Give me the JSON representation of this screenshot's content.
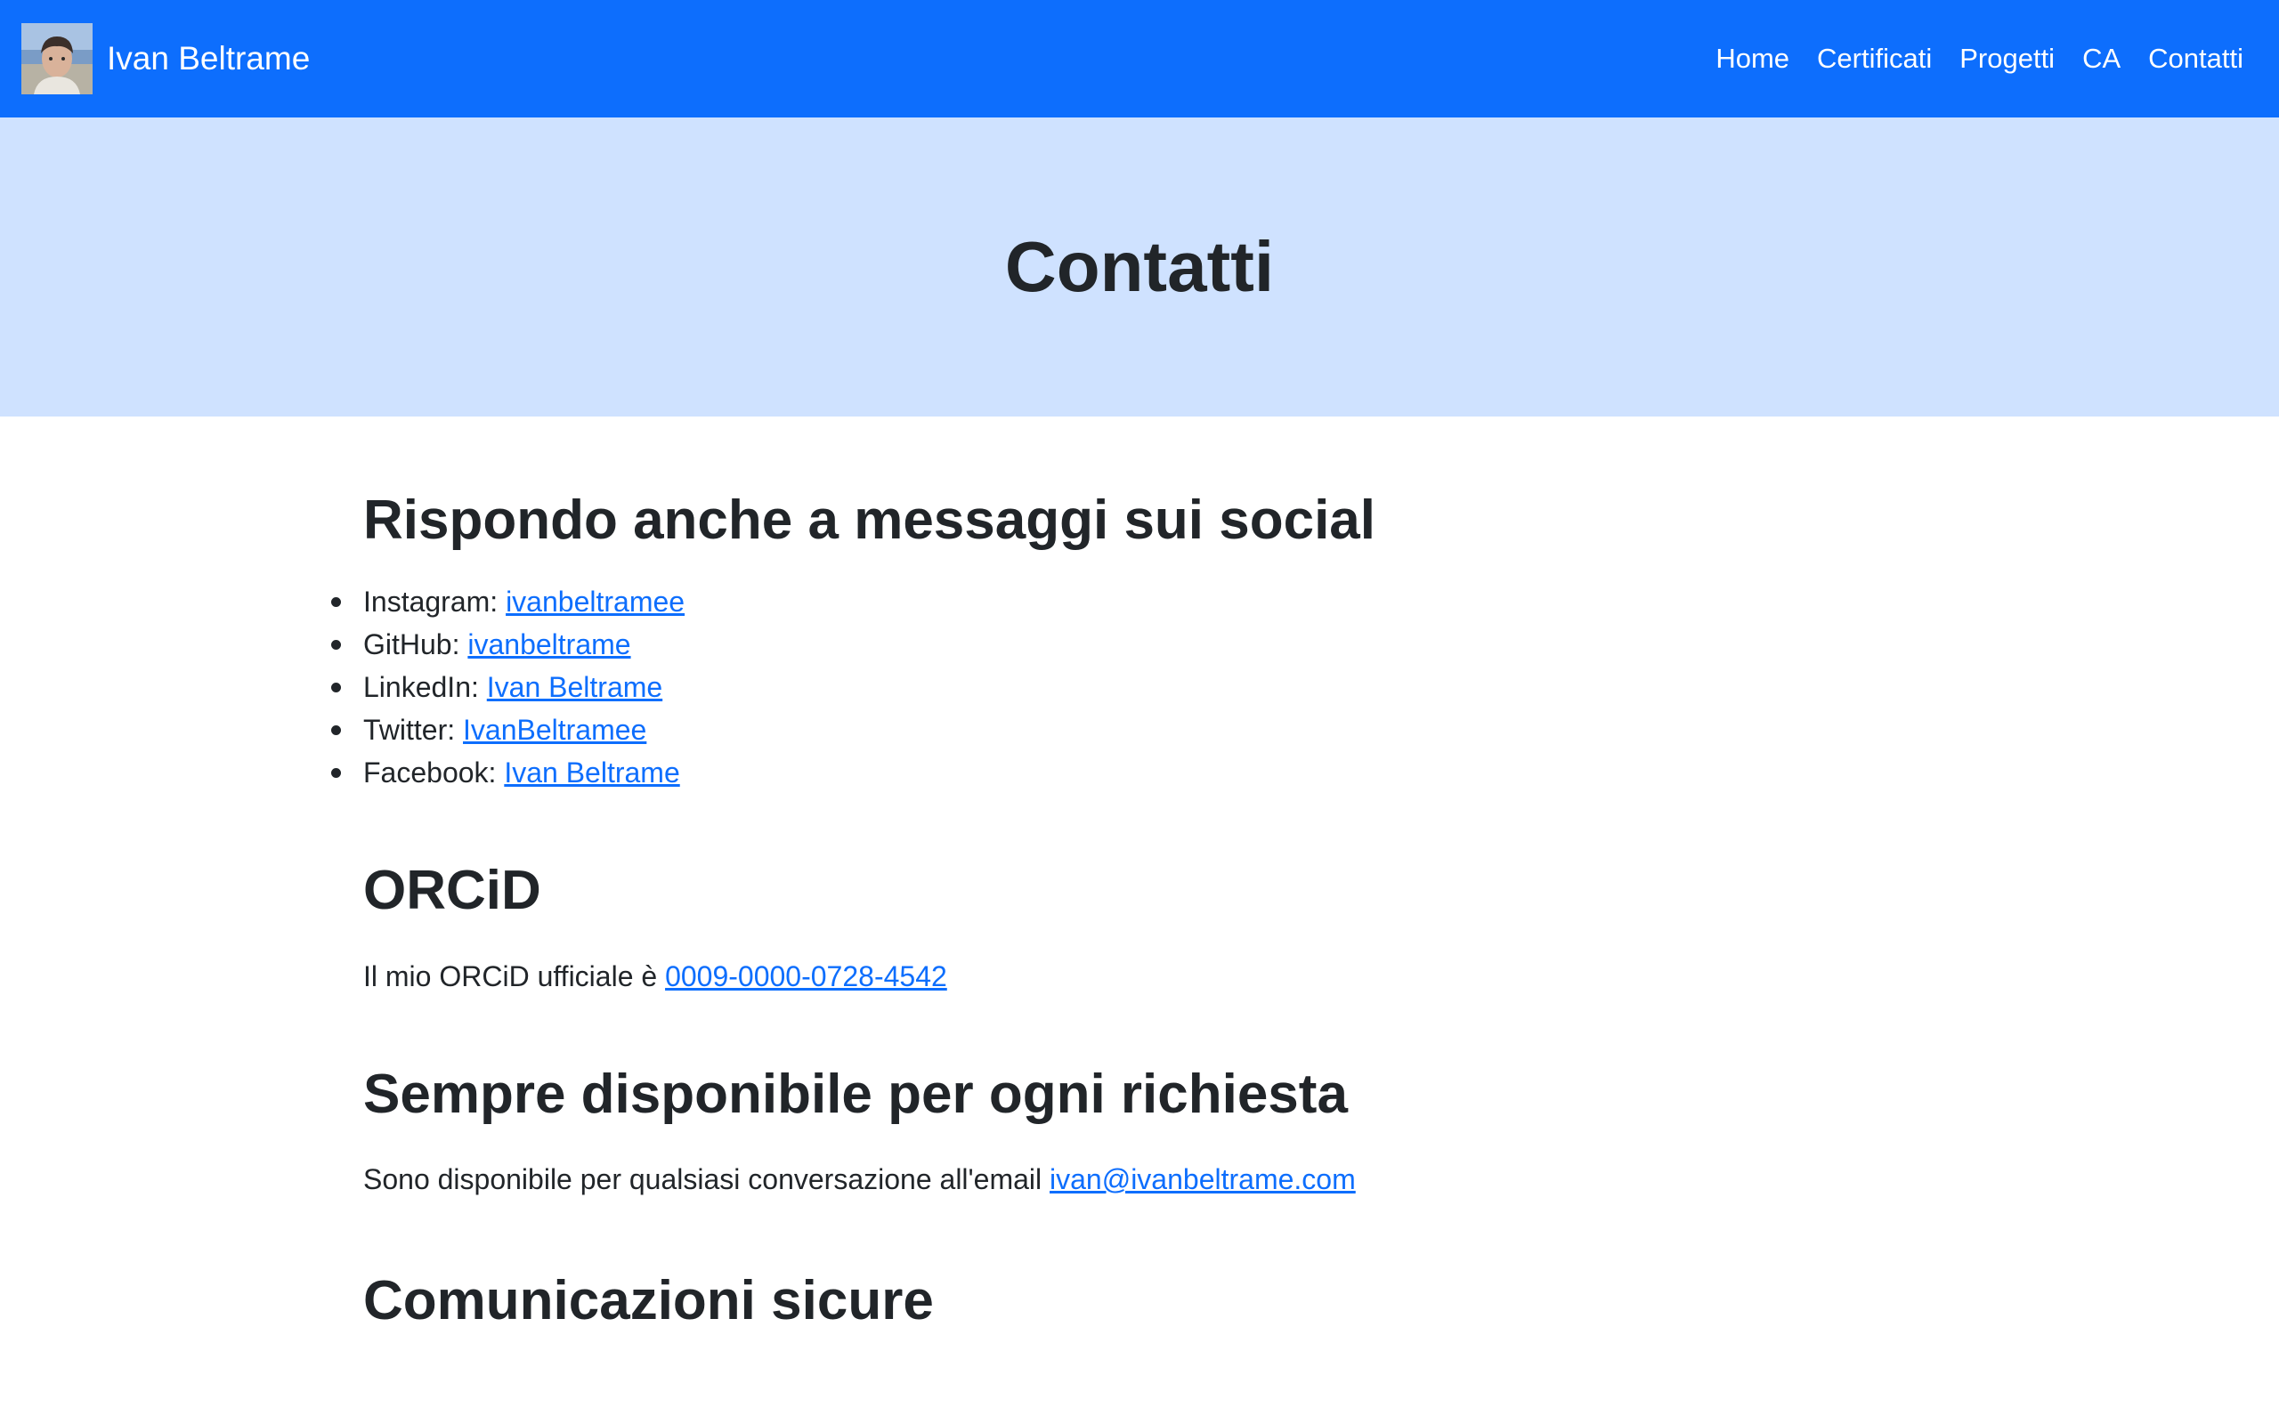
{
  "colors": {
    "navbar_bg": "#0d6efd",
    "hero_bg": "#cfe2ff",
    "link": "#0d6efd",
    "text": "#212529"
  },
  "navbar": {
    "avatar_icon": "avatar-photo-icon",
    "brand": "Ivan Beltrame",
    "links": [
      "Home",
      "Certificati",
      "Progetti",
      "CA",
      "Contatti"
    ]
  },
  "hero": {
    "title": "Contatti"
  },
  "social": {
    "heading": "Rispondo anche a messaggi sui social",
    "items": [
      {
        "label": "Instagram: ",
        "link": "ivanbeltramee"
      },
      {
        "label": "GitHub: ",
        "link": "ivanbeltrame"
      },
      {
        "label": "LinkedIn: ",
        "link": "Ivan Beltrame"
      },
      {
        "label": "Twitter: ",
        "link": "IvanBeltramee"
      },
      {
        "label": "Facebook: ",
        "link": "Ivan Beltrame"
      }
    ]
  },
  "orcid": {
    "heading": "ORCiD",
    "text": "Il mio ORCiD ufficiale è ",
    "link": "0009-0000-0728-4542"
  },
  "available": {
    "heading": "Sempre disponibile per ogni richiesta",
    "text": "Sono disponibile per qualsiasi conversazione all'email ",
    "link": "ivan@ivanbeltrame.com"
  },
  "secure": {
    "heading": "Comunicazioni sicure"
  }
}
